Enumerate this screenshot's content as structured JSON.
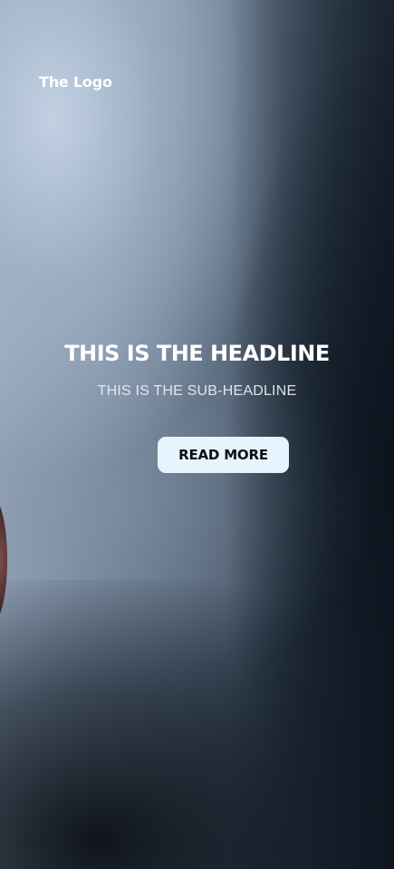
{
  "header": {
    "logo_text": "The Logo"
  },
  "hero": {
    "headline": "THIS IS THE HEADLINE",
    "subheadline": "THIS IS THE SUB-HEADLINE",
    "cta_label": "READ MORE"
  },
  "colors": {
    "button_background": "#e6f4fd",
    "button_text": "#0a0f16",
    "text_primary": "#ffffff"
  }
}
